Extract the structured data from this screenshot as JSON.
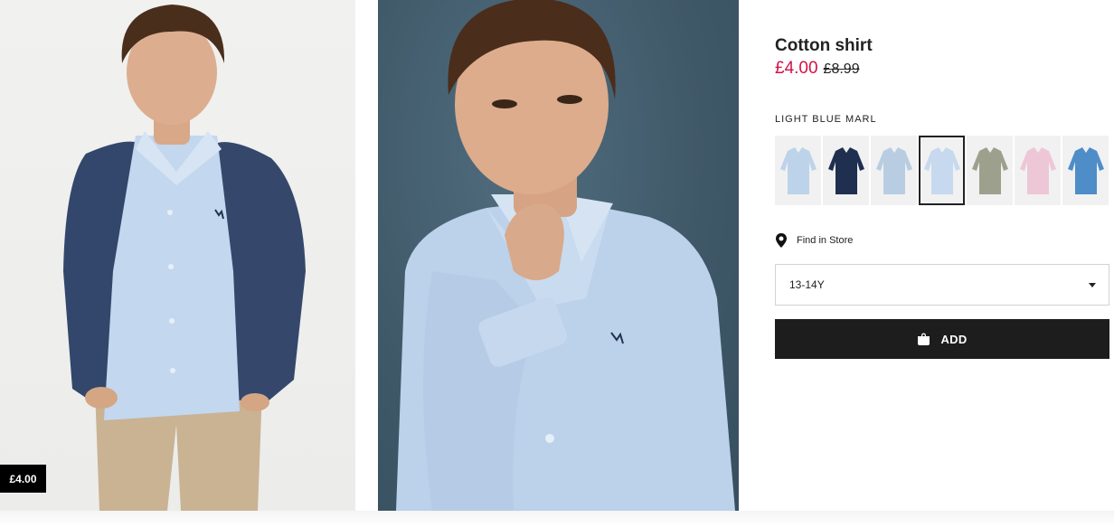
{
  "product": {
    "title": "Cotton shirt",
    "price_sale": "£4.00",
    "price_original": "£8.99",
    "image_price_chip": "£4.00",
    "selected_color_label": "LIGHT BLUE MARL"
  },
  "swatches": [
    {
      "color": "#bcd3ea",
      "name": "light-blue-shirt"
    },
    {
      "color": "#1f2f4f",
      "name": "dark-blue-shirt"
    },
    {
      "color": "#b9cde2",
      "name": "blue-striped-shirt"
    },
    {
      "color": "#c6d9ee",
      "name": "light-blue-marl-shirt"
    },
    {
      "color": "#9ea08e",
      "name": "khaki-striped-shirt"
    },
    {
      "color": "#edc7d6",
      "name": "pink-shirt"
    },
    {
      "color": "#4f8dc8",
      "name": "denim-blue-shirt"
    }
  ],
  "store": {
    "find_in_store_label": "Find in Store"
  },
  "size": {
    "selected": "13-14Y"
  },
  "cart": {
    "add_label": "ADD"
  },
  "colors": {
    "sale_price": "#d01345",
    "button_bg": "#1d1d1d"
  }
}
